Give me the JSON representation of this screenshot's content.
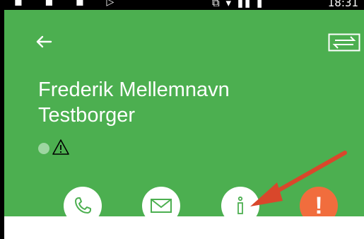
{
  "status_bar": {
    "left_icons": "◼ ◼ ◼ ▷",
    "right_icons": "⧉ ▾ ▮▮ ▮",
    "time": "18:31"
  },
  "header": {
    "background_color": "#4caf50",
    "back_icon": "arrow-left-icon",
    "switch_icon": "swap-arrows-icon"
  },
  "contact": {
    "first_line": "Frederik Mellemnavn",
    "second_line": "Testborger",
    "status_dot_color": "#9ed6a1",
    "warning_symbol": "⚠"
  },
  "actions": [
    {
      "name": "call",
      "icon": "phone-icon"
    },
    {
      "name": "email",
      "icon": "envelope-icon"
    },
    {
      "name": "info",
      "icon": "info-icon",
      "glyph": "i"
    },
    {
      "name": "alert",
      "icon": "exclamation-icon",
      "glyph": "!",
      "color": "#f16d3d"
    }
  ],
  "annotation": {
    "arrow_color": "#d9472b",
    "points_to": "info"
  }
}
